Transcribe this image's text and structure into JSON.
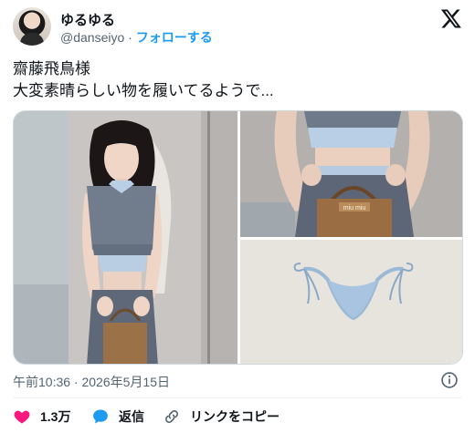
{
  "author": {
    "display_name": "ゆるゆる",
    "handle": "@danseiyo",
    "separator": "·",
    "follow_label": "フォローする"
  },
  "tweet": {
    "line1": "齋藤飛鳥様",
    "line2": "大変素晴らしい物を履いてるようで..."
  },
  "media": {
    "bag_brand": "miu miu"
  },
  "timestamp": "午前10:36 · 2026年5月15日",
  "actions": {
    "like_count": "1.3万",
    "reply_label": "返信",
    "copy_link_label": "リンクをコピー"
  },
  "colors": {
    "like": "#f91880",
    "reply": "#1d9bf0",
    "follow": "#1d9bf0",
    "secondary_text": "#536471"
  },
  "icons": {
    "logo": "x-logo-icon",
    "info": "info-icon",
    "like": "heart-icon",
    "reply": "speech-bubble-icon",
    "copy_link": "link-icon"
  }
}
